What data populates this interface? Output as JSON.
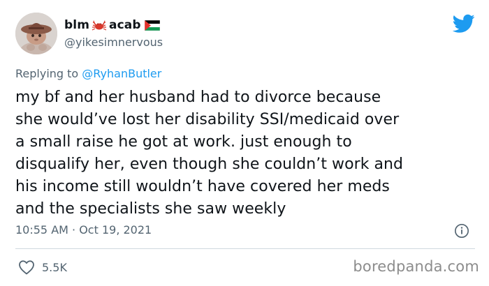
{
  "tweet": {
    "display_name_part1": "blm",
    "display_name_part2": "acab",
    "handle": "@yikesimnervous",
    "replying_prefix": "Replying to",
    "replying_to": "@RyhanButler",
    "text": "my bf and her husband had to divorce because\nshe would’ve lost her disability SSI/medicaid over\na small raise he got at work. just enough to\ndisqualify her, even though she couldn’t work and\nhis income still wouldn’t have covered her meds\nand the specialists she saw weekly",
    "timestamp": "10:55 AM · Oct 19, 2021",
    "likes": "5.5K"
  },
  "icons": {
    "avatar": "avatar-image",
    "crab": "crab-emoji-icon",
    "flag": "palestine-flag-icon",
    "twitter": "twitter-bird-icon",
    "info": "info-icon",
    "heart": "heart-icon"
  },
  "watermark": "boredpanda.com",
  "colors": {
    "twitter_blue": "#1d9bf0",
    "text_primary": "#0f1419",
    "text_secondary": "#536471",
    "divider": "#cfd9de",
    "crab_red": "#d8382c"
  }
}
